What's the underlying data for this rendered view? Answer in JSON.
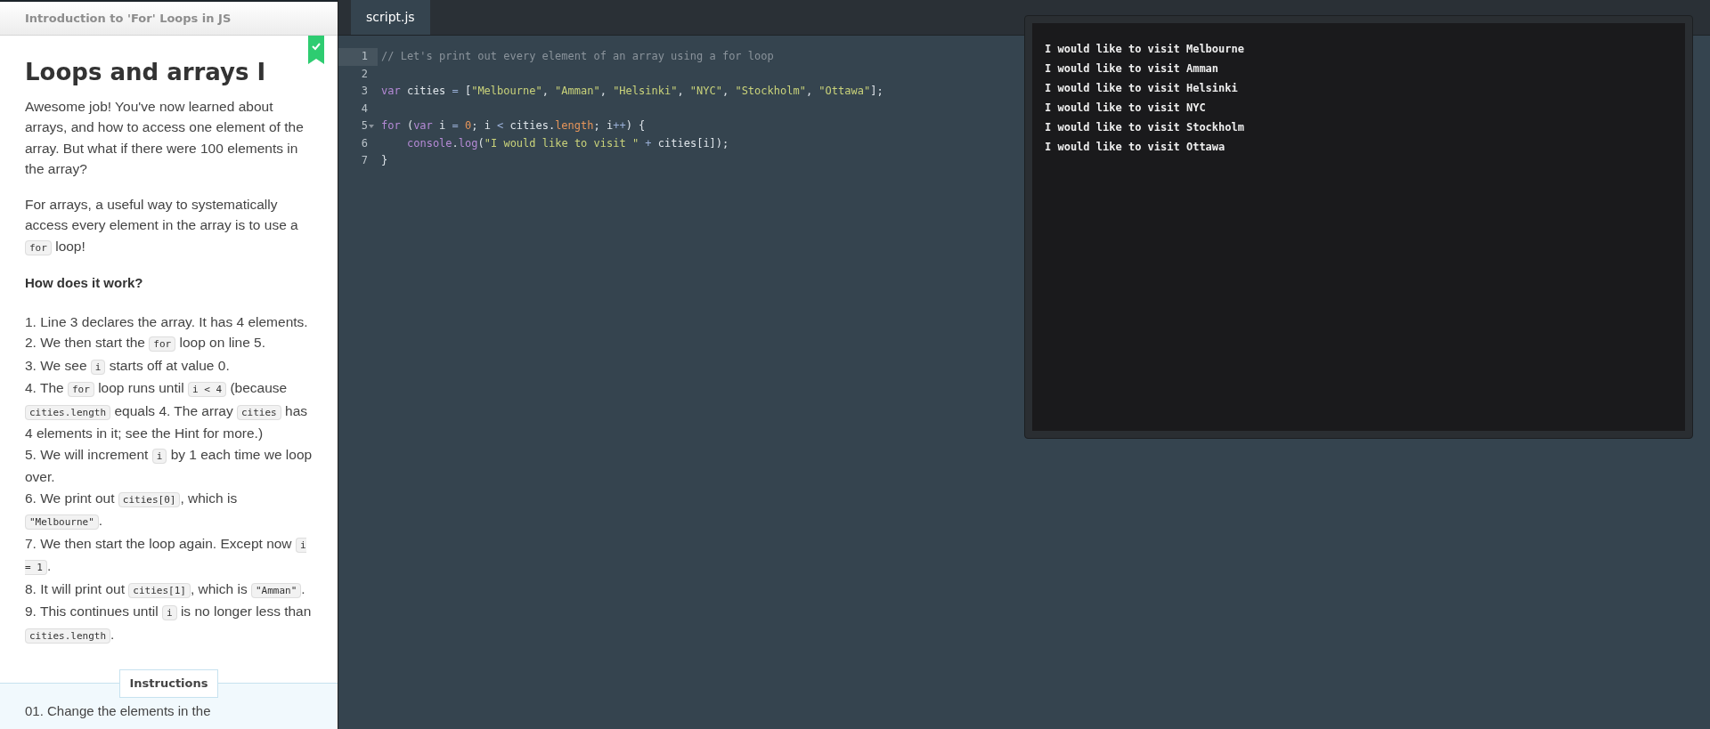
{
  "lesson": {
    "header": "Introduction to 'For' Loops in JS",
    "completed": true,
    "title": "Loops and arrays I",
    "paragraphs": [
      [
        {
          "kind": "text",
          "text": "Awesome job! You've now learned about arrays, and how to access one element of the array. But what if there were 100 elements in the array?"
        }
      ],
      [
        {
          "kind": "text",
          "text": "For arrays, a useful way to systematically access every element in the array is to use a "
        },
        {
          "kind": "code",
          "text": "for"
        },
        {
          "kind": "text",
          "text": " loop!"
        }
      ]
    ],
    "subheading": "How does it work?",
    "steps": [
      [
        {
          "kind": "text",
          "text": "1. Line 3 declares the array. It has 4 elements."
        }
      ],
      [
        {
          "kind": "text",
          "text": "2. We then start the "
        },
        {
          "kind": "code",
          "text": "for"
        },
        {
          "kind": "text",
          "text": " loop on line 5."
        }
      ],
      [
        {
          "kind": "text",
          "text": "3. We see "
        },
        {
          "kind": "code",
          "text": "i"
        },
        {
          "kind": "text",
          "text": " starts off at value 0."
        }
      ],
      [
        {
          "kind": "text",
          "text": "4. The "
        },
        {
          "kind": "code",
          "text": "for"
        },
        {
          "kind": "text",
          "text": " loop runs until "
        },
        {
          "kind": "code",
          "text": "i < 4"
        },
        {
          "kind": "text",
          "text": " (because "
        },
        {
          "kind": "code",
          "text": "cities.length"
        },
        {
          "kind": "text",
          "text": " equals 4. The array "
        },
        {
          "kind": "code",
          "text": "cities"
        },
        {
          "kind": "text",
          "text": " has 4 elements in it; see the Hint for more.)"
        }
      ],
      [
        {
          "kind": "text",
          "text": "5. We will increment "
        },
        {
          "kind": "code",
          "text": "i"
        },
        {
          "kind": "text",
          "text": " by 1 each time we loop over."
        }
      ],
      [
        {
          "kind": "text",
          "text": "6. We print out "
        },
        {
          "kind": "code",
          "text": "cities[0]"
        },
        {
          "kind": "text",
          "text": ", which is "
        },
        {
          "kind": "code",
          "text": "\"Melbourne\""
        },
        {
          "kind": "text",
          "text": "."
        }
      ],
      [
        {
          "kind": "text",
          "text": "7. We then start the loop again. Except now "
        },
        {
          "kind": "code",
          "text": "i = 1"
        },
        {
          "kind": "text",
          "text": "."
        }
      ],
      [
        {
          "kind": "text",
          "text": "8. It will print out "
        },
        {
          "kind": "code",
          "text": "cities[1]"
        },
        {
          "kind": "text",
          "text": ", which is "
        },
        {
          "kind": "code",
          "text": "\"Amman\""
        },
        {
          "kind": "text",
          "text": "."
        }
      ],
      [
        {
          "kind": "text",
          "text": "9. This continues until "
        },
        {
          "kind": "code",
          "text": "i"
        },
        {
          "kind": "text",
          "text": " is no longer less than "
        },
        {
          "kind": "code",
          "text": "cities.length"
        },
        {
          "kind": "text",
          "text": "."
        }
      ]
    ],
    "instructions_tab": "Instructions",
    "instructions_text": "01. Change the elements in the"
  },
  "editor": {
    "tabs": [
      {
        "label": "script.js",
        "selected": true
      }
    ],
    "lines": [
      {
        "number": "1",
        "fold": false,
        "tokens": [
          {
            "kind": "comment",
            "text": "// Let's print out every element of an array using a for loop"
          }
        ]
      },
      {
        "number": "2",
        "fold": false
      },
      {
        "number": "3",
        "fold": false,
        "tokens": [
          {
            "kind": "keyword",
            "text": "var"
          },
          {
            "kind": "plain",
            "text": " cities "
          },
          {
            "kind": "operator",
            "text": "="
          },
          {
            "kind": "plain",
            "text": " ["
          },
          {
            "kind": "string",
            "text": "\"Melbourne\""
          },
          {
            "kind": "plain",
            "text": ", "
          },
          {
            "kind": "string",
            "text": "\"Amman\""
          },
          {
            "kind": "plain",
            "text": ", "
          },
          {
            "kind": "string",
            "text": "\"Helsinki\""
          },
          {
            "kind": "plain",
            "text": ", "
          },
          {
            "kind": "string",
            "text": "\"NYC\""
          },
          {
            "kind": "plain",
            "text": ", "
          },
          {
            "kind": "string",
            "text": "\"Stockholm\""
          },
          {
            "kind": "plain",
            "text": ", "
          },
          {
            "kind": "string",
            "text": "\"Ottawa\""
          },
          {
            "kind": "plain",
            "text": "];"
          }
        ]
      },
      {
        "number": "4",
        "fold": false
      },
      {
        "number": "5",
        "fold": true,
        "tokens": [
          {
            "kind": "keyword",
            "text": "for"
          },
          {
            "kind": "plain",
            "text": " ("
          },
          {
            "kind": "keyword",
            "text": "var"
          },
          {
            "kind": "plain",
            "text": " i "
          },
          {
            "kind": "operator",
            "text": "="
          },
          {
            "kind": "number",
            "text": " 0"
          },
          {
            "kind": "plain",
            "text": "; i "
          },
          {
            "kind": "operator",
            "text": "<"
          },
          {
            "kind": "plain",
            "text": " cities."
          },
          {
            "kind": "property",
            "text": "length"
          },
          {
            "kind": "plain",
            "text": "; i"
          },
          {
            "kind": "operator",
            "text": "++"
          },
          {
            "kind": "plain",
            "text": ") {"
          }
        ]
      },
      {
        "number": "6",
        "fold": false,
        "indented": true,
        "tokens": [
          {
            "kind": "builtin",
            "text": "console"
          },
          {
            "kind": "plain",
            "text": "."
          },
          {
            "kind": "builtin",
            "text": "log"
          },
          {
            "kind": "plain",
            "text": "("
          },
          {
            "kind": "string",
            "text": "\"I would like to visit \""
          },
          {
            "kind": "operator",
            "text": " +"
          },
          {
            "kind": "plain",
            "text": " cities[i]);"
          }
        ]
      },
      {
        "number": "7",
        "fold": false,
        "tokens": [
          {
            "kind": "plain",
            "text": "}"
          }
        ]
      }
    ]
  },
  "console": {
    "lines": [
      "I would like to visit Melbourne",
      "I would like to visit Amman",
      "I would like to visit Helsinki",
      "I would like to visit NYC",
      "I would like to visit Stockholm",
      "I would like to visit Ottawa"
    ]
  }
}
